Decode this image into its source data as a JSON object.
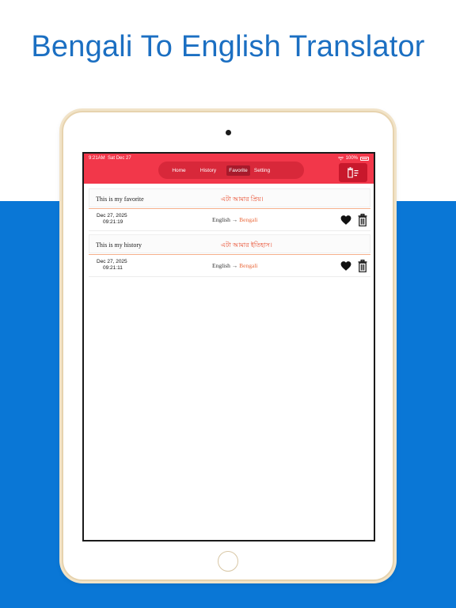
{
  "headline": "Bengali To English Translator",
  "status": {
    "time": "9:21AM",
    "date": "Sat Dec 27",
    "battery": "100%"
  },
  "tabs": [
    {
      "label": "Home"
    },
    {
      "label": "History"
    },
    {
      "label": "Favorite",
      "selected": true
    },
    {
      "label": "Setting"
    }
  ],
  "colors": {
    "accent": "#f2374a",
    "blue_bg": "#0a77d6",
    "translation": "#e8492a"
  },
  "entries": [
    {
      "source": "This is my favorite",
      "translation": "এটা আমার প্রিয়।",
      "date": "Dec 27, 2025",
      "time": "09:21:19",
      "from_lang": "English →",
      "to_lang": "Bengali"
    },
    {
      "source": "This is my history",
      "translation": "এটা আমার ইতিহাস।",
      "date": "Dec 27, 2025",
      "time": "09:21:11",
      "from_lang": "English →",
      "to_lang": "Bengali"
    }
  ]
}
